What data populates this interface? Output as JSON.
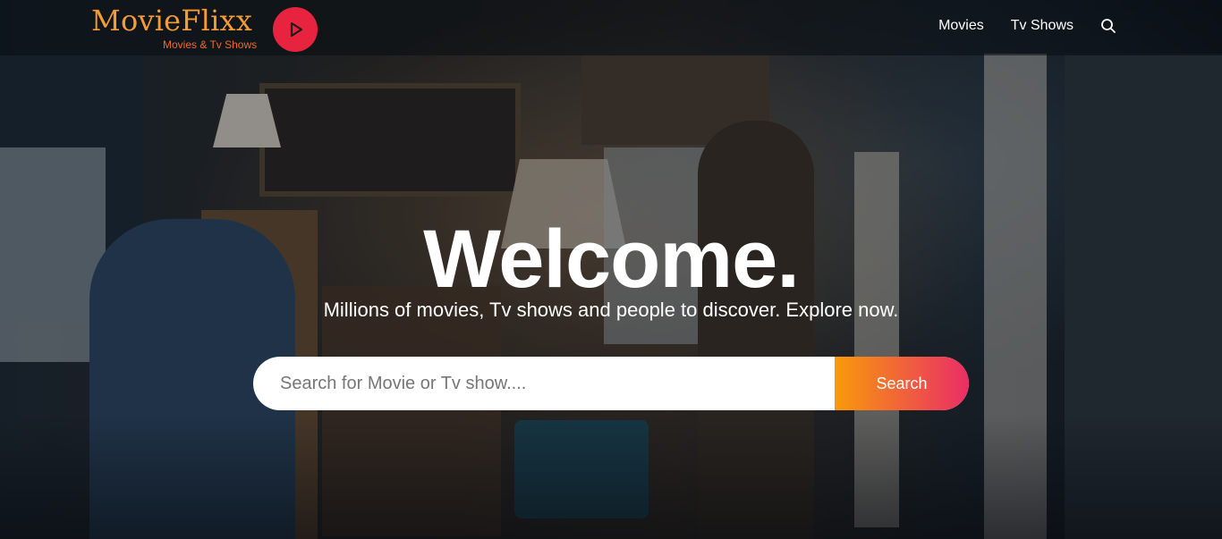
{
  "brand": {
    "name": "MovieFlixx",
    "tagline": "Movies & Tv Shows",
    "play_icon": "play-icon"
  },
  "nav": {
    "items": [
      {
        "label": "Movies"
      },
      {
        "label": "Tv Shows"
      }
    ],
    "search_icon": "search-icon"
  },
  "hero": {
    "title": "Welcome.",
    "subtitle": "Millions of movies, Tv shows and people to discover. Explore now.",
    "search": {
      "placeholder": "Search for Movie or Tv show....",
      "value": "",
      "button_label": "Search"
    }
  },
  "colors": {
    "brand_orange": "#f39c34",
    "play_red": "#e8233f",
    "button_gradient_start": "#f89a0c",
    "button_gradient_end": "#ea2d66"
  }
}
